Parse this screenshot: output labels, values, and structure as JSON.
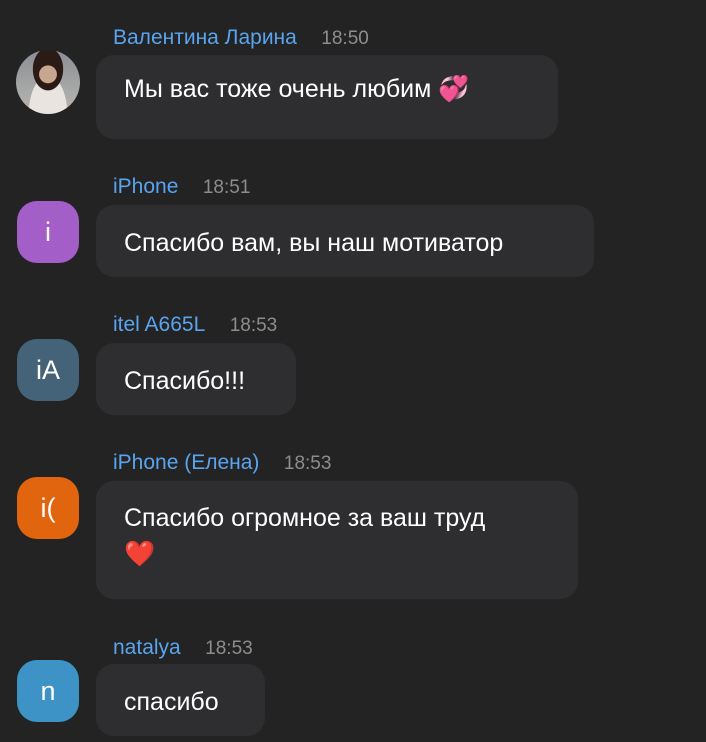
{
  "messages": [
    {
      "name": "Валентина Ларина",
      "time": "18:50",
      "avatar_text": "",
      "avatar_color": "",
      "text": "Мы вас тоже очень любим",
      "emoji": "💞"
    },
    {
      "name": "iPhone",
      "time": "18:51",
      "avatar_text": "i",
      "avatar_color": "#a35ec7",
      "text": "Спасибо вам, вы наш мотиватор",
      "emoji": ""
    },
    {
      "name": "itel A665L",
      "time": "18:53",
      "avatar_text": "iA",
      "avatar_color": "#446278",
      "text": "Спасибо!!!",
      "emoji": ""
    },
    {
      "name": "iPhone (Елена)",
      "time": "18:53",
      "avatar_text": "i(",
      "avatar_color": "#e0650e",
      "text": "Спасибо огромное за ваш труд",
      "emoji": "❤️"
    },
    {
      "name": "natalya",
      "time": "18:53",
      "avatar_text": "n",
      "avatar_color": "#3d93c6",
      "text": "спасибо",
      "emoji": ""
    }
  ],
  "colors": {
    "background": "#232323",
    "bubble": "#2e2e30",
    "name": "#5aa4ef",
    "time": "#8d8d8d"
  }
}
